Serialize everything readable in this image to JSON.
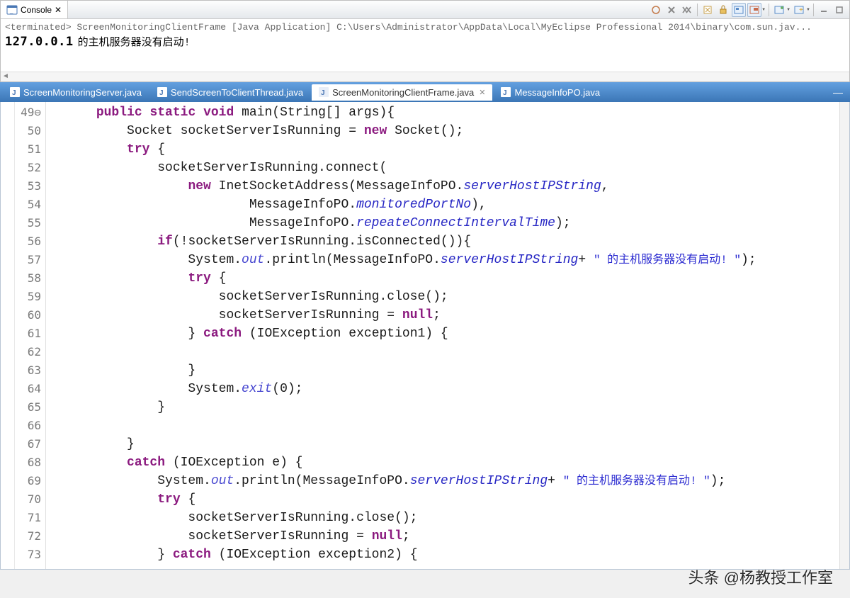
{
  "console": {
    "tab_label": "Console",
    "status": "<terminated> ScreenMonitoringClientFrame [Java Application] C:\\Users\\Administrator\\AppData\\Local\\MyEclipse Professional 2014\\binary\\com.sun.jav...",
    "output_ip": "127.0.0.1",
    "output_msg": "的主机服务器没有启动!"
  },
  "tabs": [
    {
      "label": "ScreenMonitoringServer.java",
      "active": false
    },
    {
      "label": "SendScreenToClientThread.java",
      "active": false
    },
    {
      "label": "ScreenMonitoringClientFrame.java",
      "active": true
    },
    {
      "label": "MessageInfoPO.java",
      "active": false
    }
  ],
  "gutter": [
    "49⊖",
    "50",
    "51",
    "52",
    "53",
    "54",
    "55",
    "56",
    "57",
    "58",
    "59",
    "60",
    "61",
    "62",
    "63",
    "64",
    "65",
    "66",
    "67",
    "68",
    "69",
    "70",
    "71",
    "72",
    "73"
  ],
  "code": {
    "l49a": "      ",
    "kw49a": "public",
    "l49b": " ",
    "kw49b": "static",
    "l49c": " ",
    "kw49d": "void",
    "l49e": " main(String[] args){",
    "l50a": "          Socket socketServerIsRunning = ",
    "kw50": "new",
    "l50b": " Socket();",
    "l51a": "          ",
    "kw51": "try",
    "l51b": " {",
    "l52": "              socketServerIsRunning.connect(",
    "l53a": "                  ",
    "kw53": "new",
    "l53b": " InetSocketAddress(MessageInfoPO.",
    "f53": "serverHostIPString",
    "l53c": ",",
    "l54a": "                          MessageInfoPO.",
    "f54": "monitoredPortNo",
    "l54b": "),",
    "l55a": "                          MessageInfoPO.",
    "f55": "repeateConnectIntervalTime",
    "l55b": ");",
    "l56a": "              ",
    "kw56": "if",
    "l56b": "(!socketServerIsRunning.isConnected()){",
    "l57a": "                  System.",
    "f57a": "out",
    "l57b": ".println(MessageInfoPO.",
    "f57b": "serverHostIPString",
    "l57c": "+ ",
    "s57": "\" 的主机服务器没有启动! \"",
    "l57d": ");",
    "l58a": "                  ",
    "kw58": "try",
    "l58b": " {",
    "l59": "                      socketServerIsRunning.close();",
    "l60a": "                      socketServerIsRunning = ",
    "kw60": "null",
    "l60b": ";",
    "l61a": "                  } ",
    "kw61": "catch",
    "l61b": " (IOException exception1) {",
    "l62": "",
    "l63": "                  }",
    "l64a": "                  System.",
    "f64": "exit",
    "l64b": "(0);",
    "l65": "              }",
    "l66": "",
    "l67": "          }",
    "l68a": "          ",
    "kw68": "catch",
    "l68b": " (IOException e) {",
    "l69a": "              System.",
    "f69a": "out",
    "l69b": ".println(MessageInfoPO.",
    "f69b": "serverHostIPString",
    "l69c": "+ ",
    "s69": "\" 的主机服务器没有启动! \"",
    "l69d": ");",
    "l70a": "              ",
    "kw70": "try",
    "l70b": " {",
    "l71": "                  socketServerIsRunning.close();",
    "l72a": "                  socketServerIsRunning = ",
    "kw72": "null",
    "l72b": ";",
    "l73a": "              } ",
    "kw73": "catch",
    "l73b": " (IOException exception2) {"
  },
  "watermark": "头条 @杨教授工作室"
}
